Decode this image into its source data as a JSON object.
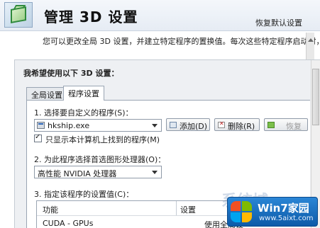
{
  "header": {
    "title": "管理 3D 设置",
    "restore_defaults": "恢复默认设置",
    "description": "您可以更改全局 3D 设置，并建立特定程序的置换值。每次这些特定程序启动时，都"
  },
  "panel": {
    "heading": "我希望使用以下 3D 设置：",
    "tabs": [
      {
        "label": "全局设置",
        "active": false
      },
      {
        "label": "程序设置",
        "active": true
      }
    ],
    "step1": {
      "label": "1. 选择要自定义的程序(S)：",
      "program_value": "hkship.exe",
      "add_button": "添加(D)",
      "remove_button": "删除(R)",
      "restore_button": "恢复",
      "checkbox_label": "只显示本计算机上找到的程序(M)",
      "checkbox_checked": true,
      "checkbox_mark": "✓"
    },
    "step2": {
      "label": "2. 为此程序选择首选图形处理器(O)：",
      "processor_value": "高性能 NVIDIA 处理器"
    },
    "step3": {
      "label": "3. 指定该程序的设置值(C)：",
      "columns": [
        "功能",
        "设置"
      ],
      "rows": [
        {
          "feature": "CUDA - GPUs",
          "setting": "使用全局设"
        }
      ]
    }
  },
  "watermark": {
    "ghost_text": "系统城",
    "title": "Win7家园",
    "url": "www.5aixt.com"
  },
  "colors": {
    "header_bg": "#e6ecf4",
    "panel_bg": "#eef0f3",
    "watermark_blue": "#1a6fc0"
  }
}
